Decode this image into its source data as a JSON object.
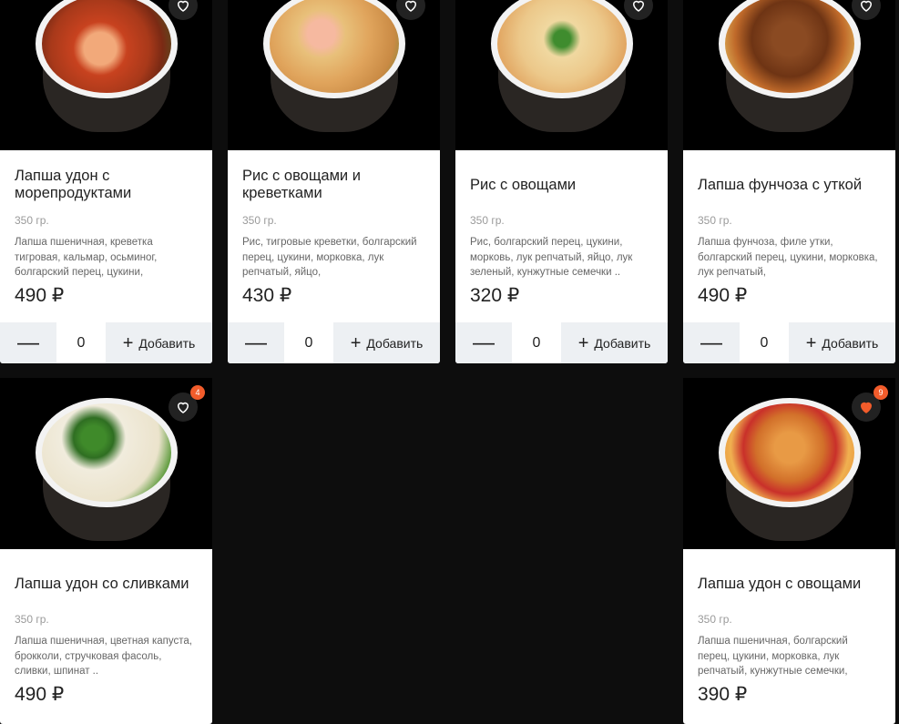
{
  "cards": [
    {
      "title": "Лапша удон с морепродуктами",
      "weight": "350 гр.",
      "desc": "Лапша пшеничная, креветка тигровая, кальмар, осьминог, болгарский перец, цукини,",
      "price": "490 ₽",
      "qty": "0",
      "add_label": "Добавить",
      "badge": ""
    },
    {
      "title": "Рис с овощами и креветками",
      "weight": "350 гр.",
      "desc": "Рис, тигровые креветки, болгарский перец, цукини, морковка, лук репчатый, яйцо,",
      "price": "430 ₽",
      "qty": "0",
      "add_label": "Добавить",
      "badge": ""
    },
    {
      "title": "Рис с овощами",
      "weight": "350 гр.",
      "desc": "Рис, болгарский перец, цукини, морковь, лук репчатый, яйцо, лук зеленый, кунжутные семечки ..",
      "price": "320 ₽",
      "qty": "0",
      "add_label": "Добавить",
      "badge": ""
    },
    {
      "title": "Лапша фунчоза с уткой",
      "weight": "350 гр.",
      "desc": "Лапша фунчоза, филе утки, болгарский перец, цукини, морковка, лук репчатый,",
      "price": "490 ₽",
      "qty": "0",
      "add_label": "Добавить",
      "badge": ""
    },
    {
      "title": "Лапша удон со сливками",
      "weight": "350 гр.",
      "desc": "Лапша пшеничная, цветная капуста, брокколи, стручковая фасоль, сливки, шпинат ..",
      "price": "490 ₽",
      "badge": "4"
    },
    {
      "title": "Лапша удон с овощами",
      "weight": "350 гр.",
      "desc": "Лапша пшеничная, болгарский перец, цукини, морковка, лук репчатый, кунжутные семечки,",
      "price": "390 ₽",
      "badge": "9"
    }
  ],
  "icons": {
    "favorite": "heart-outline-icon",
    "favorite_active": "heart-filled-icon",
    "minus": "minus-icon",
    "plus": "plus-icon"
  },
  "colors": {
    "accent": "#f25c2b",
    "button_bg": "#edf0f3",
    "page_bg": "#0d0d0d"
  }
}
